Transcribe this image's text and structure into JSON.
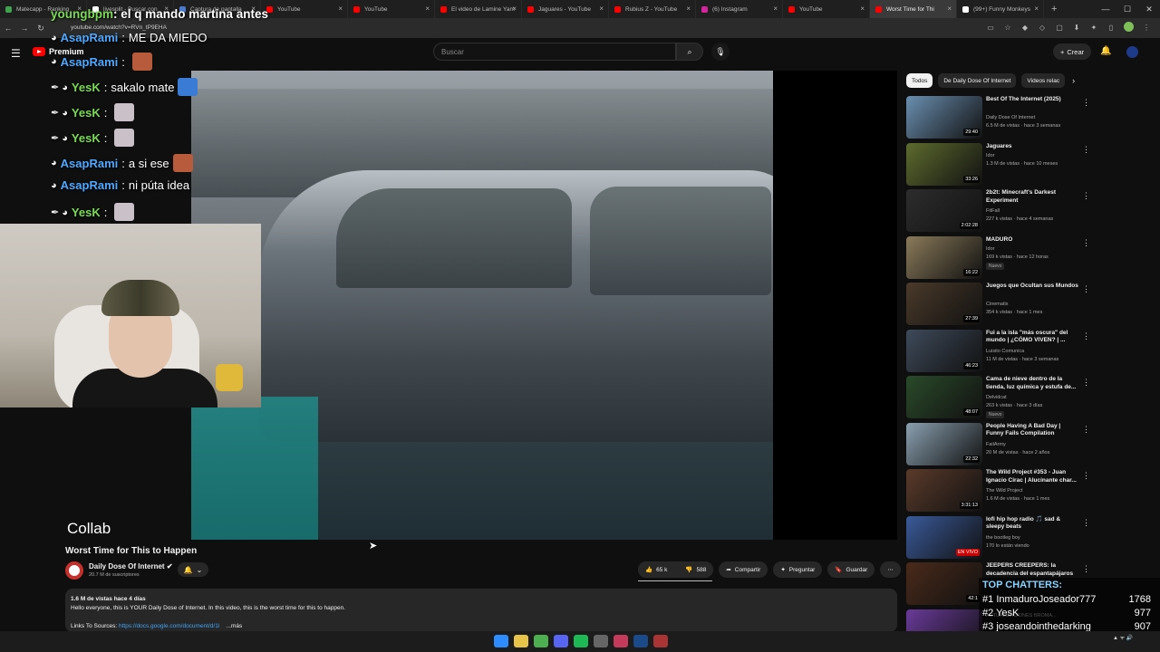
{
  "browser": {
    "tabs": [
      {
        "label": "Matecapp - Ranking",
        "color": "#3fa34d"
      },
      {
        "label": "livesplit - Buscar con",
        "color": "#ffffff"
      },
      {
        "label": "Captura de pantalla",
        "color": "#4a7bd1"
      },
      {
        "label": "YouTube",
        "color": "#ff0000"
      },
      {
        "label": "YouTube",
        "color": "#ff0000"
      },
      {
        "label": "El video de Lamine Yam",
        "color": "#ff0000"
      },
      {
        "label": "Jaguares - YouTube",
        "color": "#ff0000"
      },
      {
        "label": "Rubius Z - YouTube",
        "color": "#ff0000"
      },
      {
        "label": "(6) Instagram",
        "color": "#d6249f"
      },
      {
        "label": "YouTube",
        "color": "#ff0000"
      },
      {
        "label": "Worst Time for Thi",
        "color": "#ff0000"
      },
      {
        "label": "(99+) Funny Monkeys",
        "color": "#ffffff"
      }
    ],
    "url": "youtube.com/watch?v=RVn_tP9EHA"
  },
  "youtube": {
    "logo": "Premium",
    "search_placeholder": "Buscar",
    "create_label": "Crear"
  },
  "overlay": {
    "top_user": "youngbpm",
    "top_text": "el q mando martina antes",
    "messages": [
      {
        "user": "AsapRami",
        "text": "ME DA MIEDO",
        "color": "#4fa8ff",
        "emote": ""
      },
      {
        "user": "AsapRami",
        "text": "",
        "color": "#4fa8ff",
        "emote": "#b85a3c"
      },
      {
        "user": "YesK",
        "text": "sakalo mate",
        "color": "#7cd957",
        "emote": "#3a7bd5"
      },
      {
        "user": "YesK",
        "text": "",
        "color": "#7cd957",
        "emote": "#c9c0c8"
      },
      {
        "user": "YesK",
        "text": "",
        "color": "#7cd957",
        "emote": "#c9c0c8"
      },
      {
        "user": "AsapRami",
        "text": "a si ese",
        "color": "#4fa8ff",
        "emote": "#b85a3c"
      },
      {
        "user": "AsapRami",
        "text": "ni púta idea",
        "color": "#4fa8ff",
        "emote": ""
      },
      {
        "user": "YesK",
        "text": "",
        "color": "#7cd957",
        "emote": "#c9c0c8"
      }
    ],
    "collab": "Collab",
    "top_chatters_title": "TOP CHATTERS:",
    "top_chatters": [
      {
        "rank": "#1",
        "name": "InmaduroJoseador777",
        "count": "1768"
      },
      {
        "rank": "#2",
        "name": "YesK",
        "count": "977"
      },
      {
        "rank": "#3",
        "name": "joseandointhedarking",
        "count": "907"
      }
    ]
  },
  "video": {
    "title": "Worst Time for This to Happen",
    "channel": "Daily Dose Of Internet",
    "subscribers": "20.7 M de suscriptores",
    "likes": "65 k",
    "dislikes": "588",
    "share": "Compartir",
    "ask": "Preguntar",
    "save": "Guardar",
    "views": "1.6 M de vistas  hace 4 días",
    "description": "Hello everyone, this is YOUR Daily Dose of Internet. In this video, this is the worst time for this to happen.",
    "links_label": "Links To Sources: ",
    "links_url": "https://docs.google.com/document/d/1l",
    "more": "...más"
  },
  "sidebar": {
    "chips": [
      "Todos",
      "De Daily Dose Of Internet",
      "Videos relac"
    ],
    "recs": [
      {
        "title": "Best Of The Internet (2025)",
        "channel": "Daily Dose Of Internet",
        "meta": "6.5 M de vistas · hace 3 semanas",
        "duration": "29:40",
        "badge": "",
        "thumb": "#6a8fb0"
      },
      {
        "title": "Jaguares",
        "channel": "Idor",
        "meta": "1.3 M de vistas · hace 10 meses",
        "duration": "33:26",
        "badge": "",
        "thumb": "#5d6b2e"
      },
      {
        "title": "2b2t: Minecraft's Darkest Experiment",
        "channel": "FitFall",
        "meta": "227 k vistas · hace 4 semanas",
        "duration": "2:02:28",
        "badge": "",
        "thumb": "#2d2d2d"
      },
      {
        "title": "MADURO",
        "channel": "Idor",
        "meta": "169 k vistas · hace 12 horas",
        "duration": "16:22",
        "badge": "Nuevo",
        "thumb": "#8a7a5a"
      },
      {
        "title": "Juegos que Ocultan sus Mundos",
        "channel": "Cinematix",
        "meta": "354 k vistas · hace 1 mes",
        "duration": "27:39",
        "badge": "",
        "thumb": "#4a3a2a"
      },
      {
        "title": "Fui a la isla \"más oscura\" del mundo | ¿CÓMO VIVEN? | ...",
        "channel": "Luisito Comunica",
        "meta": "11 M de vistas · hace 3 semanas",
        "duration": "46:23",
        "badge": "",
        "thumb": "#3e4a5a"
      },
      {
        "title": "Cama de nieve dentro de la tienda, luz química y estufa de...",
        "channel": "Delvidcat",
        "meta": "263 k vistas · hace 3 días",
        "duration": "48:07",
        "badge": "Nuevo",
        "thumb": "#2a4a2a"
      },
      {
        "title": "People Having A Bad Day | Funny Fails Compilation",
        "channel": "FailArmy",
        "meta": "20 M de vistas · hace 2 años",
        "duration": "22:32",
        "badge": "",
        "thumb": "#8aa0b0"
      },
      {
        "title": "The Wild Project #353 - Juan Ignacio Cirac | Alucinante char...",
        "channel": "The Wild Project",
        "meta": "1.6 M de vistas · hace 1 mes",
        "duration": "3:31:13",
        "badge": "",
        "thumb": "#5a3a2a"
      },
      {
        "title": "lofi hip hop radio 🎵 sad & sleepy beats",
        "channel": "the bootleg boy",
        "meta": "170 lo están viendo",
        "duration": "EN VIVO",
        "badge": "",
        "thumb": "#3a5a9a"
      },
      {
        "title": "JEEPERS CREEPERS: la decadencia del espantapájaros",
        "channel": "",
        "meta": "",
        "duration": "42:1",
        "badge": "",
        "thumb": "#4a2a1a"
      },
      {
        "title": "",
        "channel": "ACTUALIZACIONES BROMA...",
        "meta": "",
        "duration": "",
        "badge": "",
        "thumb": "#6a3a9a"
      }
    ]
  }
}
